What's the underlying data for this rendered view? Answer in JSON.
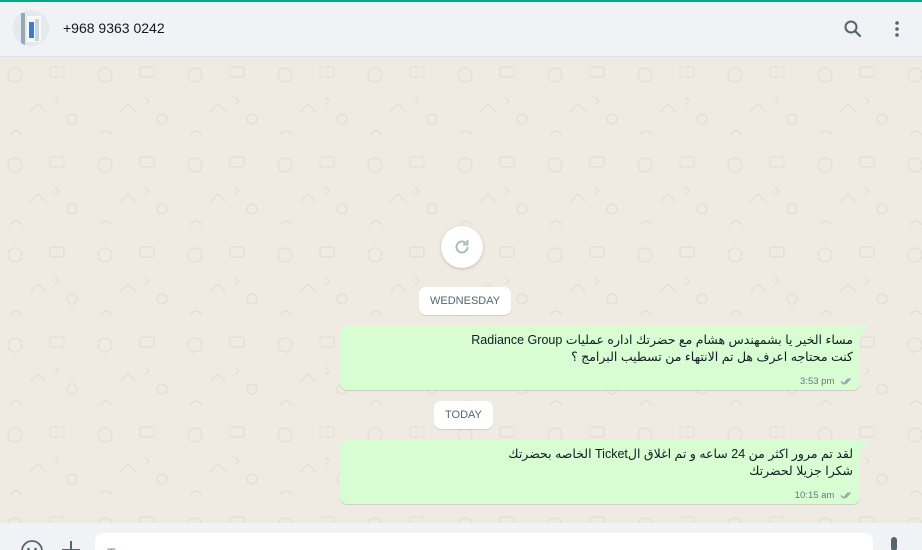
{
  "header": {
    "contact_name": "+968 9363 0242",
    "icons": [
      "avatar",
      "search-icon",
      "menu-icon"
    ]
  },
  "chat": {
    "reload_icon": "reload-icon",
    "days": [
      {
        "label": "WEDNESDAY",
        "messages": [
          {
            "lines": [
              "مساء الخير يا بشمهندس هشام مع حضرتك اداره عمليات Radiance Group",
              "كنت محتاجه اعرف هل تم الانتهاء من تسطيب البرامج ؟"
            ],
            "time": "3:53 pm",
            "status": "read"
          }
        ]
      },
      {
        "label": "TODAY",
        "messages": [
          {
            "lines": [
              "لقد تم مرور اكثر من  24 ساعه و تم اغلاق الTicket الخاصه بحضرتك",
              "شكرا جزيلا لحضرتك"
            ],
            "time": "10:15 am",
            "status": "read"
          }
        ]
      }
    ]
  },
  "composer": {
    "placeholder": "Type a message",
    "icons": [
      "emoji-icon",
      "attach-icon",
      "mic-icon"
    ]
  },
  "colors": {
    "accent": "#00a884",
    "outgoing_bubble": "#d9fdd3",
    "chat_background": "#efeae2",
    "header_background": "#f0f2f5"
  }
}
